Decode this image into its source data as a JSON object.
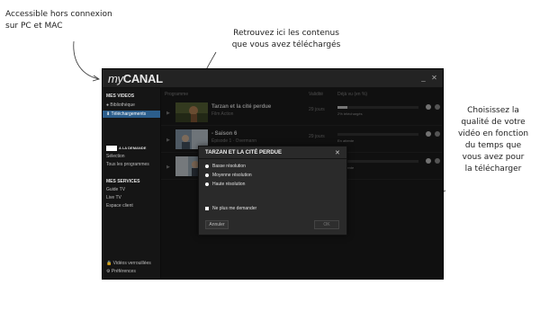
{
  "annotations": {
    "left": "Accessible hors connexion\nsur PC et MAC",
    "top": "Retrouvez ici les contenus\nque vous avez téléchargés",
    "right": "Choisissez la\nqualité de votre\nvidéo en fonction\ndu temps que\nvous avez pour\nla télécharger"
  },
  "window": {
    "logo_my": "my",
    "logo_brand": "CANAL",
    "minimize": "_",
    "close": "✕"
  },
  "sidebar": {
    "mes_videos": "MES VIDEOS",
    "bibliotheque": "Bibliothèque",
    "telechargements": "Téléchargements",
    "canal_demand": "A LA DEMANDE",
    "selection": "Sélection",
    "tous_programmes": "Tous les programmes",
    "mes_services": "MES SERVICES",
    "guide_tv": "Guide TV",
    "live_tv": "Live TV",
    "espace_client": "Espace client",
    "videos_verrouillees": "Vidéos verrouillées",
    "preferences": "Préférences"
  },
  "table": {
    "col_programme": "Programme",
    "col_validite": "Validité",
    "col_telecharge": "Déjà vu (en %)",
    "rows": [
      {
        "title": "Tarzan et la cité perdue",
        "subtitle": "Film Action",
        "validity": "29 jours",
        "progress": 0.12,
        "progress_label": "2% téléchargés"
      },
      {
        "title": "- Saison 6",
        "subtitle": "Épisode 1 · Overmann",
        "validity": "29 jours",
        "progress": 0.0,
        "progress_label": "En attente"
      },
      {
        "title": "",
        "subtitle": "",
        "validity": "",
        "progress": 0.0,
        "progress_label": "En attente"
      }
    ]
  },
  "dialog": {
    "title": "TARZAN ET LA CITÉ PERDUE",
    "close": "✕",
    "options": [
      "Basse résolution",
      "Moyenne résolution",
      "Haute résolution"
    ],
    "checkbox": "Ne plus me demander",
    "cancel": "Annuler",
    "ok": "OK"
  },
  "colors": {
    "accent": "#2c5e8c",
    "window_bg": "#1b1b1b",
    "dialog_bg": "#2a2a2a"
  }
}
